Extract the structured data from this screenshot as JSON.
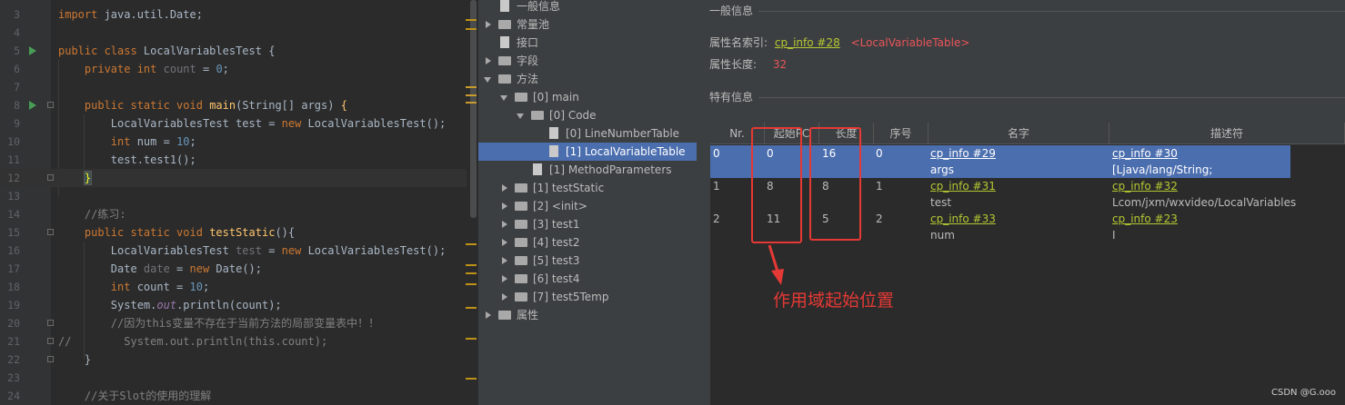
{
  "editor": {
    "lines": [
      {
        "n": "3",
        "html": "<span class=\"kw\">import</span> java.util.Date;"
      },
      {
        "n": "4",
        "html": ""
      },
      {
        "n": "5",
        "html": "<span class=\"kw\">public class</span> LocalVariablesTest {"
      },
      {
        "n": "6",
        "html": "    <span class=\"kw\">private int</span> <span class=\"unused\">count</span> = <span class=\"num\">0</span>;"
      },
      {
        "n": "7",
        "html": ""
      },
      {
        "n": "8",
        "html": "    <span class=\"kw\">public static void</span> <span class=\"fn\">main</span>(String[] args) <span class=\"fn\">{</span>"
      },
      {
        "n": "9",
        "html": "        LocalVariablesTest test = <span class=\"kw\">new</span> LocalVariablesTest();"
      },
      {
        "n": "10",
        "html": "        <span class=\"kw\">int</span> num = <span class=\"num\">10</span>;"
      },
      {
        "n": "11",
        "html": "        test.test1();"
      },
      {
        "n": "12",
        "html": "    <span class=\"brace-hl\">}</span>"
      },
      {
        "n": "13",
        "html": ""
      },
      {
        "n": "14",
        "html": "    <span class=\"cm\">//练习:</span>"
      },
      {
        "n": "15",
        "html": "    <span class=\"kw\">public static void</span> <span class=\"fn\">testStatic</span>(){"
      },
      {
        "n": "16",
        "html": "        LocalVariablesTest <span class=\"unused\">test</span> = <span class=\"kw\">new</span> LocalVariablesTest();"
      },
      {
        "n": "17",
        "html": "        Date <span class=\"unused\">date</span> = <span class=\"kw\">new</span> Date();"
      },
      {
        "n": "18",
        "html": "        <span class=\"kw\">int</span> count = <span class=\"num\">10</span>;"
      },
      {
        "n": "19",
        "html": "        System.<span class=\"st\">out</span>.println(count);"
      },
      {
        "n": "20",
        "html": "        <span class=\"cm\">//因为this变量不存在于当前方法的局部变量表中！！</span>"
      },
      {
        "n": "21",
        "html": "<span class=\"cm\">//        System.out.println(this.count);</span>"
      },
      {
        "n": "22",
        "html": "    }"
      },
      {
        "n": "23",
        "html": ""
      },
      {
        "n": "24",
        "html": "    <span class=\"cm\">//关于Slot的使用的理解</span>"
      }
    ]
  },
  "tree": {
    "items": [
      {
        "label": "一般信息",
        "arrow": "none",
        "icon": "file-icon",
        "indent": 0
      },
      {
        "label": "常量池",
        "arrow": "right",
        "icon": "folder-icon",
        "indent": 0
      },
      {
        "label": "接口",
        "arrow": "none",
        "icon": "file-icon",
        "indent": 0
      },
      {
        "label": "字段",
        "arrow": "right",
        "icon": "folder-icon",
        "indent": 0
      },
      {
        "label": "方法",
        "arrow": "down",
        "icon": "folder-icon",
        "indent": 0
      },
      {
        "label": "[0] main",
        "arrow": "down",
        "icon": "folder-icon",
        "indent": 1
      },
      {
        "label": "[0] Code",
        "arrow": "down",
        "icon": "folder-icon",
        "indent": 2
      },
      {
        "label": "[0] LineNumberTable",
        "arrow": "none",
        "icon": "file-icon",
        "indent": 3
      },
      {
        "label": "[1] LocalVariableTable",
        "arrow": "none",
        "icon": "file-icon",
        "indent": 3,
        "selected": true
      },
      {
        "label": "[1] MethodParameters",
        "arrow": "none",
        "icon": "file-icon",
        "indent": 2
      },
      {
        "label": "[1] testStatic",
        "arrow": "right",
        "icon": "folder-icon",
        "indent": 1
      },
      {
        "label": "[2] <init>",
        "arrow": "right",
        "icon": "folder-icon",
        "indent": 1
      },
      {
        "label": "[3] test1",
        "arrow": "right",
        "icon": "folder-icon",
        "indent": 1
      },
      {
        "label": "[4] test2",
        "arrow": "right",
        "icon": "folder-icon",
        "indent": 1
      },
      {
        "label": "[5] test3",
        "arrow": "right",
        "icon": "folder-icon",
        "indent": 1
      },
      {
        "label": "[6] test4",
        "arrow": "right",
        "icon": "folder-icon",
        "indent": 1
      },
      {
        "label": "[7] test5Temp",
        "arrow": "right",
        "icon": "folder-icon",
        "indent": 1
      },
      {
        "label": "属性",
        "arrow": "right",
        "icon": "folder-icon",
        "indent": 0
      }
    ]
  },
  "panel": {
    "general_title": "一般信息",
    "name_index_label": "属性名索引:",
    "name_index_link": "cp_info #28",
    "name_index_value": "<LocalVariableTable>",
    "length_label": "属性长度:",
    "length_value": "32",
    "specific_title": "特有信息",
    "columns": [
      "Nr.",
      "起始PC",
      "长度",
      "序号",
      "名字",
      "描述符"
    ],
    "rows": [
      {
        "nr": "0",
        "start_pc": "0",
        "length": "16",
        "index": "0",
        "name_link": "cp_info #29",
        "name": "args",
        "desc_link": "cp_info #30",
        "desc": "[Ljava/lang/String;",
        "selected": true
      },
      {
        "nr": "1",
        "start_pc": "8",
        "length": "8",
        "index": "1",
        "name_link": "cp_info #31",
        "name": "test",
        "desc_link": "cp_info #32",
        "desc": "Lcom/jxm/wxvideo/LocalVariables"
      },
      {
        "nr": "2",
        "start_pc": "11",
        "length": "5",
        "index": "2",
        "name_link": "cp_info #33",
        "name": "num",
        "desc_link": "cp_info #23",
        "desc": "I"
      }
    ],
    "annotation": "作用域起始位置",
    "watermark": "CSDN @G.ooo"
  },
  "colors": {
    "annotation_red": "#e53935",
    "link": "#b5c832",
    "selection": "#4b6eaf"
  }
}
